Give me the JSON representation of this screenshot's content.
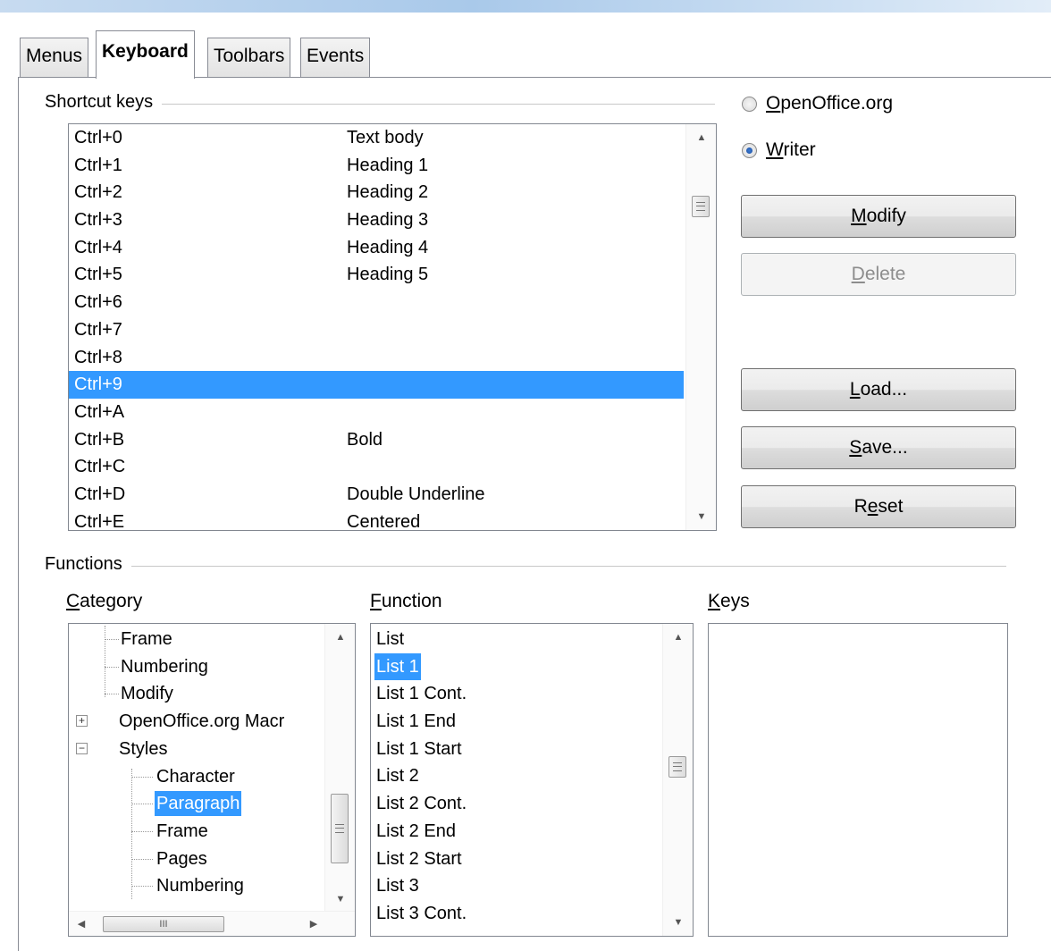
{
  "tabs": [
    {
      "label": "Menus",
      "active": false
    },
    {
      "label": "Keyboard",
      "active": true
    },
    {
      "label": "Toolbars",
      "active": false
    },
    {
      "label": "Events",
      "active": false
    }
  ],
  "shortcut_group": {
    "label": "Shortcut keys"
  },
  "shortcuts": [
    {
      "key": "Ctrl+0",
      "command": "Text body",
      "selected": false
    },
    {
      "key": "Ctrl+1",
      "command": "Heading 1",
      "selected": false
    },
    {
      "key": "Ctrl+2",
      "command": "Heading 2",
      "selected": false
    },
    {
      "key": "Ctrl+3",
      "command": "Heading 3",
      "selected": false
    },
    {
      "key": "Ctrl+4",
      "command": "Heading 4",
      "selected": false
    },
    {
      "key": "Ctrl+5",
      "command": "Heading 5",
      "selected": false
    },
    {
      "key": "Ctrl+6",
      "command": "",
      "selected": false
    },
    {
      "key": "Ctrl+7",
      "command": "",
      "selected": false
    },
    {
      "key": "Ctrl+8",
      "command": "",
      "selected": false
    },
    {
      "key": "Ctrl+9",
      "command": "",
      "selected": true
    },
    {
      "key": "Ctrl+A",
      "command": "",
      "selected": false
    },
    {
      "key": "Ctrl+B",
      "command": "Bold",
      "selected": false
    },
    {
      "key": "Ctrl+C",
      "command": "",
      "selected": false
    },
    {
      "key": "Ctrl+D",
      "command": "Double Underline",
      "selected": false
    },
    {
      "key": "Ctrl+E",
      "command": "Centered",
      "selected": false
    }
  ],
  "scope": {
    "openoffice_first": "O",
    "openoffice_rest": "penOffice.org",
    "writer_first": "W",
    "writer_rest": "riter",
    "selected": "Writer"
  },
  "buttons": {
    "modify": {
      "pre": "",
      "u": "M",
      "post": "odify"
    },
    "delete": {
      "pre": "",
      "u": "D",
      "post": "elete",
      "enabled": false
    },
    "load": {
      "pre": "",
      "u": "L",
      "post": "oad..."
    },
    "save": {
      "pre": "",
      "u": "S",
      "post": "ave..."
    },
    "reset": {
      "pre": "R",
      "u": "e",
      "post": "set"
    }
  },
  "functions_group": {
    "label": "Functions"
  },
  "columns": {
    "category": {
      "u": "C",
      "rest": "ategory"
    },
    "function": {
      "u": "F",
      "rest": "unction"
    },
    "keys": {
      "u": "K",
      "rest": "eys"
    }
  },
  "categories": [
    {
      "label": "Frame",
      "level": 1,
      "expander": "",
      "selected": false
    },
    {
      "label": "Numbering",
      "level": 1,
      "expander": "",
      "selected": false
    },
    {
      "label": "Modify",
      "level": 1,
      "expander": "",
      "selected": false
    },
    {
      "label": "OpenOffice.org Macr",
      "level": 0,
      "expander": "+",
      "selected": false
    },
    {
      "label": "Styles",
      "level": 0,
      "expander": "−",
      "selected": false
    },
    {
      "label": "Character",
      "level": 2,
      "expander": "",
      "selected": false
    },
    {
      "label": "Paragraph",
      "level": 2,
      "expander": "",
      "selected": true
    },
    {
      "label": "Frame",
      "level": 2,
      "expander": "",
      "selected": false
    },
    {
      "label": "Pages",
      "level": 2,
      "expander": "",
      "selected": false
    },
    {
      "label": "Numbering",
      "level": 2,
      "expander": "",
      "selected": false
    }
  ],
  "functions": [
    {
      "label": "List",
      "selected": false
    },
    {
      "label": "List 1",
      "selected": true
    },
    {
      "label": "List 1 Cont.",
      "selected": false
    },
    {
      "label": "List 1 End",
      "selected": false
    },
    {
      "label": "List 1 Start",
      "selected": false
    },
    {
      "label": "List 2",
      "selected": false
    },
    {
      "label": "List 2 Cont.",
      "selected": false
    },
    {
      "label": "List 2 End",
      "selected": false
    },
    {
      "label": "List 2 Start",
      "selected": false
    },
    {
      "label": "List 3",
      "selected": false
    },
    {
      "label": "List 3 Cont.",
      "selected": false
    }
  ],
  "keys": [],
  "scrollbar": {
    "hscroll_grip": "III"
  },
  "colors": {
    "selection": "#3399ff",
    "border": "#828790"
  }
}
